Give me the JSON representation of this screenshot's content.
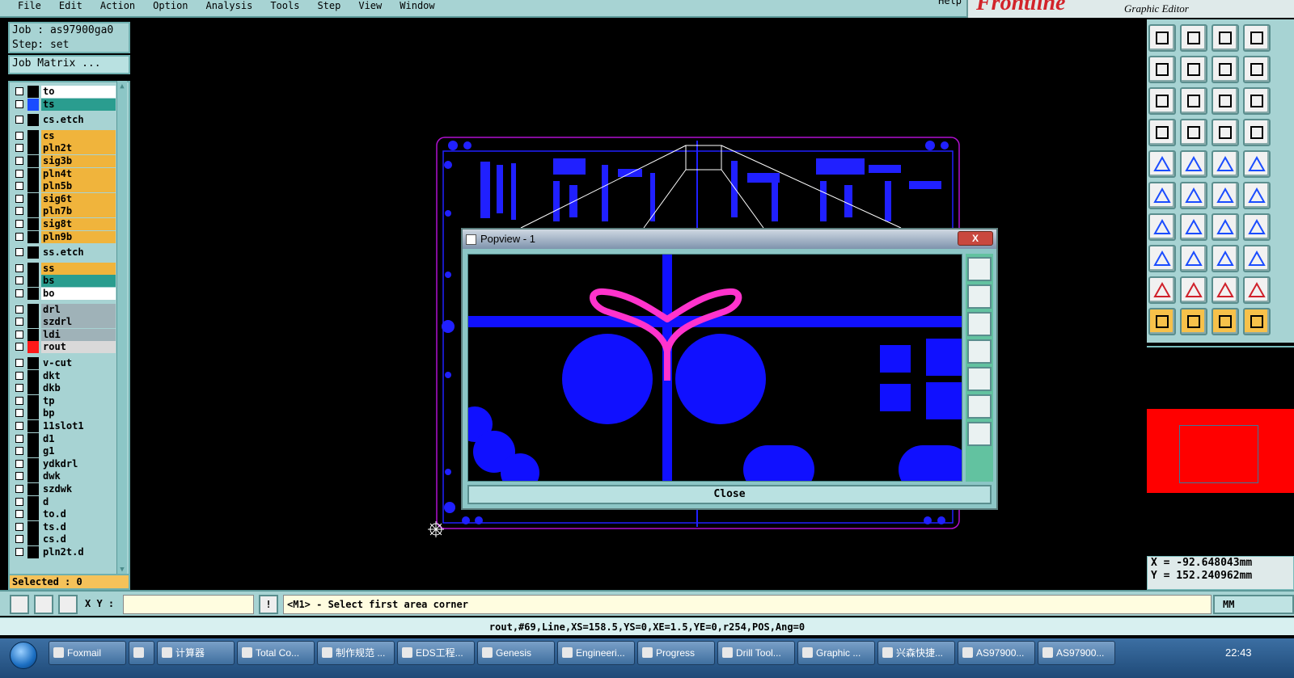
{
  "menubar": {
    "items": [
      "File",
      "Edit",
      "Action",
      "Option",
      "Analysis",
      "Tools",
      "Step",
      "View",
      "Window"
    ],
    "help": "Help"
  },
  "brand": {
    "logo": "Frontline",
    "subtitle": "Graphic Editor"
  },
  "job": {
    "job_label": "Job : as97900ga0",
    "step_label": "Step: set",
    "matrix_button": "Job Matrix ..."
  },
  "layers": [
    {
      "name": "to",
      "color": "#ffffff",
      "dot": "#000000"
    },
    {
      "name": "ts",
      "color": "#2a9d8f",
      "dot": "#1a4cff"
    },
    {
      "name": "cs.etch",
      "color": "#a7d3d3",
      "dot": "#000000"
    },
    {
      "name": "cs",
      "color": "#f0b43c",
      "dot": "#000000"
    },
    {
      "name": "pln2t",
      "color": "#f0b43c",
      "dot": "#000000"
    },
    {
      "name": "sig3b",
      "color": "#f0b43c",
      "dot": "#000000"
    },
    {
      "name": "pln4t",
      "color": "#f0b43c",
      "dot": "#000000"
    },
    {
      "name": "pln5b",
      "color": "#f0b43c",
      "dot": "#000000"
    },
    {
      "name": "sig6t",
      "color": "#f0b43c",
      "dot": "#000000"
    },
    {
      "name": "pln7b",
      "color": "#f0b43c",
      "dot": "#000000"
    },
    {
      "name": "sig8t",
      "color": "#f0b43c",
      "dot": "#000000"
    },
    {
      "name": "pln9b",
      "color": "#f0b43c",
      "dot": "#000000"
    },
    {
      "name": "ss.etch",
      "color": "#a7d3d3",
      "dot": "#000000"
    },
    {
      "name": "ss",
      "color": "#f0b43c",
      "dot": "#000000"
    },
    {
      "name": "bs",
      "color": "#2a9d8f",
      "dot": "#000000"
    },
    {
      "name": "bo",
      "color": "#ffffff",
      "dot": "#000000"
    },
    {
      "name": "drl",
      "color": "#9fb2b8",
      "dot": "#000000"
    },
    {
      "name": "szdrl",
      "color": "#9fb2b8",
      "dot": "#000000"
    },
    {
      "name": "ldi",
      "color": "#9fb2b8",
      "dot": "#000000"
    },
    {
      "name": "rout",
      "color": "#d9d9d9",
      "dot": "#ff1a1a"
    },
    {
      "name": "v-cut",
      "color": "#a7d3d3",
      "dot": "#000000"
    },
    {
      "name": "dkt",
      "color": "#a7d3d3",
      "dot": "#000000"
    },
    {
      "name": "dkb",
      "color": "#a7d3d3",
      "dot": "#000000"
    },
    {
      "name": "tp",
      "color": "#a7d3d3",
      "dot": "#000000"
    },
    {
      "name": "bp",
      "color": "#a7d3d3",
      "dot": "#000000"
    },
    {
      "name": "11slot1",
      "color": "#a7d3d3",
      "dot": "#000000"
    },
    {
      "name": "d1",
      "color": "#a7d3d3",
      "dot": "#000000"
    },
    {
      "name": "g1",
      "color": "#a7d3d3",
      "dot": "#000000"
    },
    {
      "name": "ydkdrl",
      "color": "#a7d3d3",
      "dot": "#000000"
    },
    {
      "name": "dwk",
      "color": "#a7d3d3",
      "dot": "#000000"
    },
    {
      "name": "szdwk",
      "color": "#a7d3d3",
      "dot": "#000000"
    },
    {
      "name": "d",
      "color": "#a7d3d3",
      "dot": "#000000"
    },
    {
      "name": "to.d",
      "color": "#a7d3d3",
      "dot": "#000000"
    },
    {
      "name": "ts.d",
      "color": "#a7d3d3",
      "dot": "#000000"
    },
    {
      "name": "cs.d",
      "color": "#a7d3d3",
      "dot": "#000000"
    },
    {
      "name": "pln2t.d",
      "color": "#a7d3d3",
      "dot": "#000000"
    }
  ],
  "selected": "Selected : 0",
  "coords": {
    "x": "X = -92.648043mm",
    "y": "Y = 152.240962mm"
  },
  "popview": {
    "title": "Popview - 1",
    "close_x": "X",
    "close_button": "Close"
  },
  "command": {
    "xy_label": "X Y :",
    "xy_value": "",
    "alert": "!",
    "prompt": "<M1> - Select first area corner",
    "units": "MM"
  },
  "status": "rout,#69,Line,XS=158.5,YS=0,XE=1.5,YE=0,r254,POS,Ang=0",
  "taskbar": {
    "tasks": [
      "Foxmail",
      "",
      "计算器",
      "Total Co...",
      "制作规范 ...",
      "EDS工程...",
      "Genesis",
      "Engineeri...",
      "Progress",
      "Drill Tool...",
      "Graphic ...",
      "兴森快捷...",
      "AS97900...",
      "AS97900..."
    ],
    "time": "22:43"
  },
  "colors": {
    "panel": "#a7d3d3",
    "board": "#1010ff",
    "rout": "#ff33cc",
    "highlight": "#ff0000"
  }
}
